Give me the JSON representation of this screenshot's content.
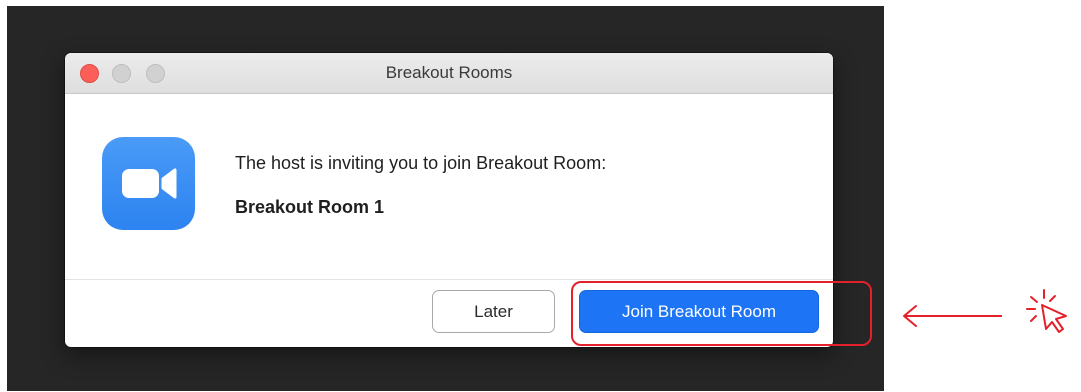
{
  "window": {
    "title": "Breakout Rooms"
  },
  "dialog": {
    "app_icon": "zoom-camera-icon",
    "message": "The host is inviting you to join Breakout Room:",
    "room_name": "Breakout Room 1"
  },
  "buttons": {
    "later_label": "Later",
    "join_label": "Join Breakout Room"
  },
  "annotation": {
    "highlight_color": "#e4202b",
    "arrow_icon": "left-arrow-icon",
    "cursor_icon": "click-cursor-icon"
  },
  "colors": {
    "accent": "#1d74f5",
    "icon_blue": "#2d83f0",
    "close_red": "#fc5f57"
  }
}
